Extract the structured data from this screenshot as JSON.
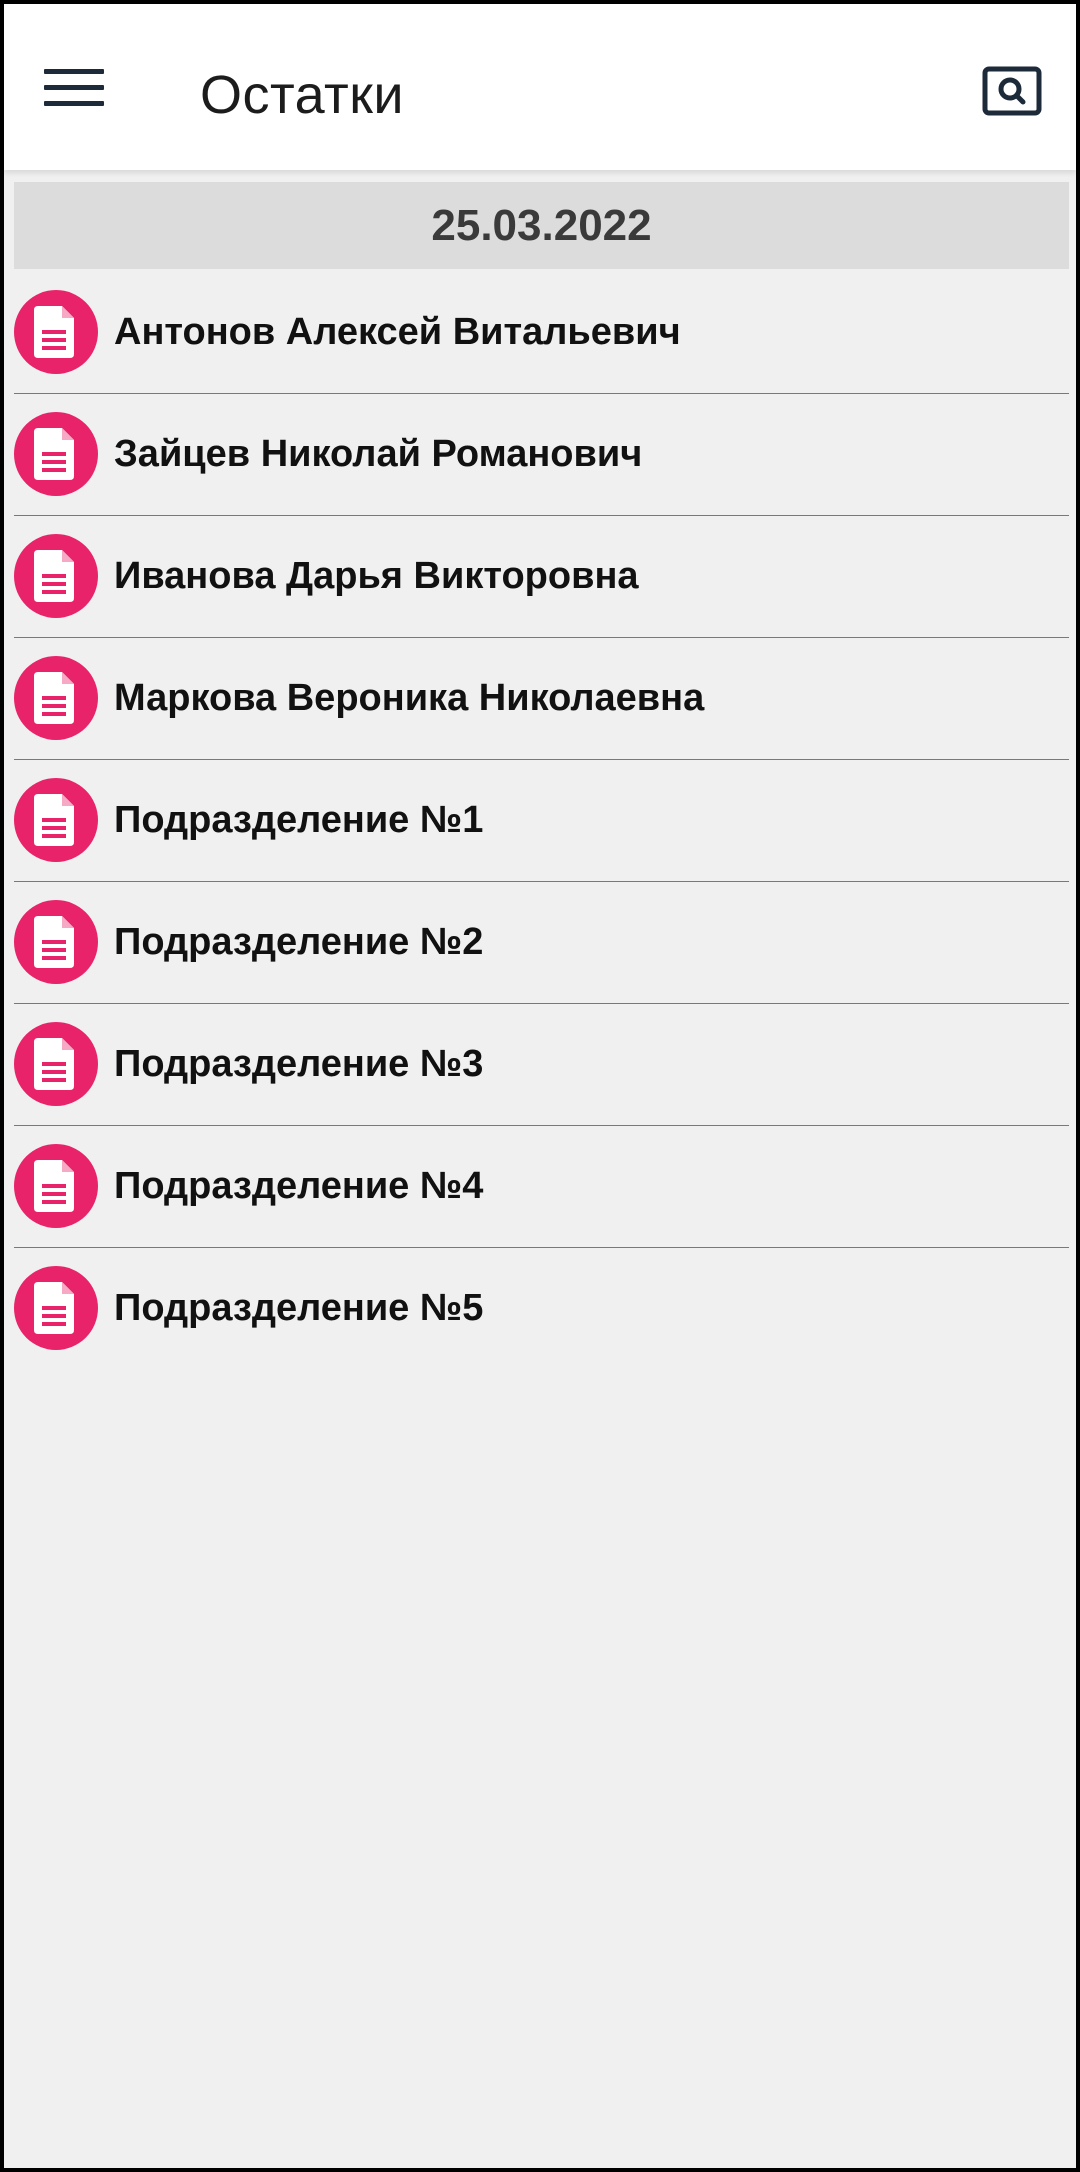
{
  "app_bar": {
    "title": "Остатки",
    "menu_icon": "hamburger-menu-icon",
    "search_icon": "search-icon"
  },
  "date_header": "25.03.2022",
  "items": [
    {
      "label": "Антонов Алексей Витальевич",
      "icon": "document-icon"
    },
    {
      "label": "Зайцев Николай Романович",
      "icon": "document-icon"
    },
    {
      "label": "Иванова Дарья Викторовна",
      "icon": "document-icon"
    },
    {
      "label": "Маркова Вероника Николаевна",
      "icon": "document-icon"
    },
    {
      "label": "Подразделение №1",
      "icon": "document-icon"
    },
    {
      "label": "Подразделение №2",
      "icon": "document-icon"
    },
    {
      "label": "Подразделение №3",
      "icon": "document-icon"
    },
    {
      "label": "Подразделение №4",
      "icon": "document-icon"
    },
    {
      "label": "Подразделение №5",
      "icon": "document-icon"
    }
  ],
  "colors": {
    "accent": "#e8236a",
    "icon_dark": "#1c2a3a",
    "background": "#f0f0f0",
    "date_header_bg": "#dcdcdc",
    "divider": "#6b7c8f"
  }
}
